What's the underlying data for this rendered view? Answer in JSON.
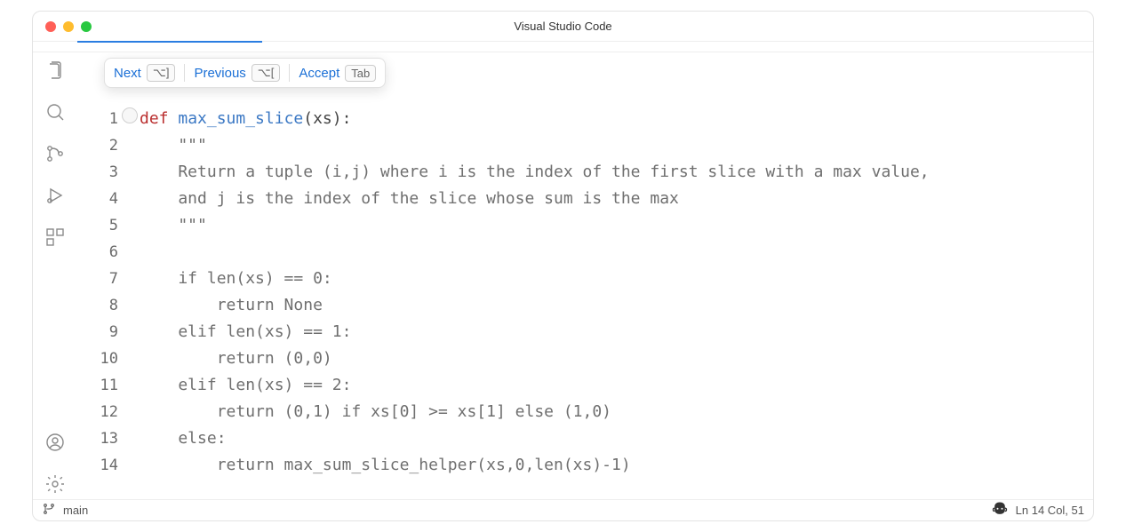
{
  "window": {
    "title": "Visual Studio Code"
  },
  "suggest": {
    "next_label": "Next",
    "next_key": "⌥]",
    "prev_label": "Previous",
    "prev_key": "⌥[",
    "accept_label": "Accept",
    "accept_key": "Tab"
  },
  "code": {
    "lines": [
      {
        "n": "1",
        "segments": [
          {
            "t": "def ",
            "c": "kw"
          },
          {
            "t": "max_sum_slice",
            "c": "fn"
          },
          {
            "t": "(xs):",
            "c": "punct"
          }
        ]
      },
      {
        "n": "2",
        "segments": [
          {
            "t": "    \"\"\"",
            "c": "txt"
          }
        ]
      },
      {
        "n": "3",
        "segments": [
          {
            "t": "    Return a tuple (i,j) where i is the index of the first slice with a max value,",
            "c": "txt"
          }
        ]
      },
      {
        "n": "4",
        "segments": [
          {
            "t": "    and j is the index of the slice whose sum is the max",
            "c": "txt"
          }
        ]
      },
      {
        "n": "5",
        "segments": [
          {
            "t": "    \"\"\"",
            "c": "txt"
          }
        ]
      },
      {
        "n": "6",
        "segments": [
          {
            "t": "",
            "c": "txt"
          }
        ]
      },
      {
        "n": "7",
        "segments": [
          {
            "t": "    if len(xs) == 0:",
            "c": "txt"
          }
        ]
      },
      {
        "n": "8",
        "segments": [
          {
            "t": "        return None",
            "c": "txt"
          }
        ]
      },
      {
        "n": "9",
        "segments": [
          {
            "t": "    elif len(xs) == 1:",
            "c": "txt"
          }
        ]
      },
      {
        "n": "10",
        "segments": [
          {
            "t": "        return (0,0)",
            "c": "txt"
          }
        ]
      },
      {
        "n": "11",
        "segments": [
          {
            "t": "    elif len(xs) == 2:",
            "c": "txt"
          }
        ]
      },
      {
        "n": "12",
        "segments": [
          {
            "t": "        return (0,1) if xs[0] >= xs[1] else (1,0)",
            "c": "txt"
          }
        ]
      },
      {
        "n": "13",
        "segments": [
          {
            "t": "    else:",
            "c": "txt"
          }
        ]
      },
      {
        "n": "14",
        "segments": [
          {
            "t": "        return max_sum_slice_helper(xs,0,len(xs)-1)",
            "c": "txt"
          }
        ]
      }
    ]
  },
  "status": {
    "branch": "main",
    "position": "Ln 14 Col, 51"
  }
}
